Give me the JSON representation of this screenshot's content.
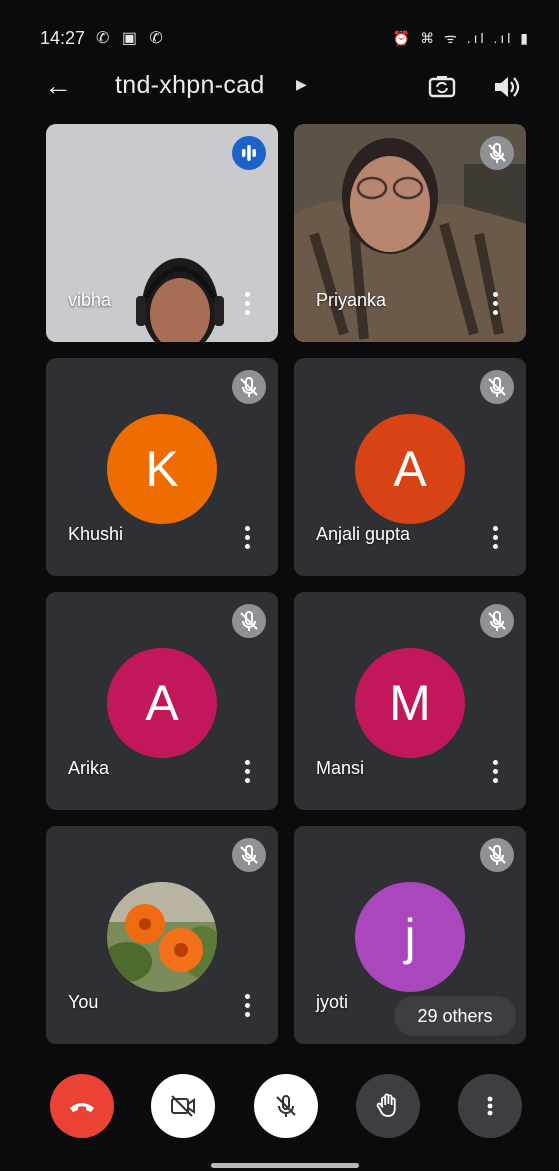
{
  "status_bar": {
    "time": "14:27",
    "left_icons": "✆ ▣ ✆",
    "right_icons": "⏰ ⌘ ᯤ .ıl .ıl ▮"
  },
  "header": {
    "meeting_code": "tnd-xhpn-cad"
  },
  "participants": [
    {
      "name": "vibha",
      "type": "video",
      "speaking": true
    },
    {
      "name": "Priyanka",
      "type": "video",
      "muted": true
    },
    {
      "name": "Khushi",
      "initial": "K",
      "avatar_color": "#ef6c00",
      "muted": true
    },
    {
      "name": "Anjali gupta",
      "initial": "A",
      "avatar_color": "#d84315",
      "muted": true
    },
    {
      "name": "Arika",
      "initial": "A",
      "avatar_color": "#c2185b",
      "muted": true
    },
    {
      "name": "Mansi",
      "initial": "M",
      "avatar_color": "#c2185b",
      "muted": true
    },
    {
      "name": "You",
      "type": "photo-avatar",
      "muted": true
    },
    {
      "name": "jyoti",
      "initial": "j",
      "avatar_color": "#ab47bc",
      "muted": true
    }
  ],
  "others_badge": "29 others",
  "controls": {
    "end_call": {
      "icon": "end-call-icon",
      "color": "#ea4335"
    },
    "camera": {
      "icon": "camera-off-icon",
      "color": "#ffffff"
    },
    "mic": {
      "icon": "mic-off-icon",
      "color": "#ffffff"
    },
    "raise_hand": {
      "icon": "raise-hand-icon",
      "color": "#3c3e42"
    },
    "more": {
      "icon": "more-options-icon",
      "color": "#3c3e42"
    }
  }
}
